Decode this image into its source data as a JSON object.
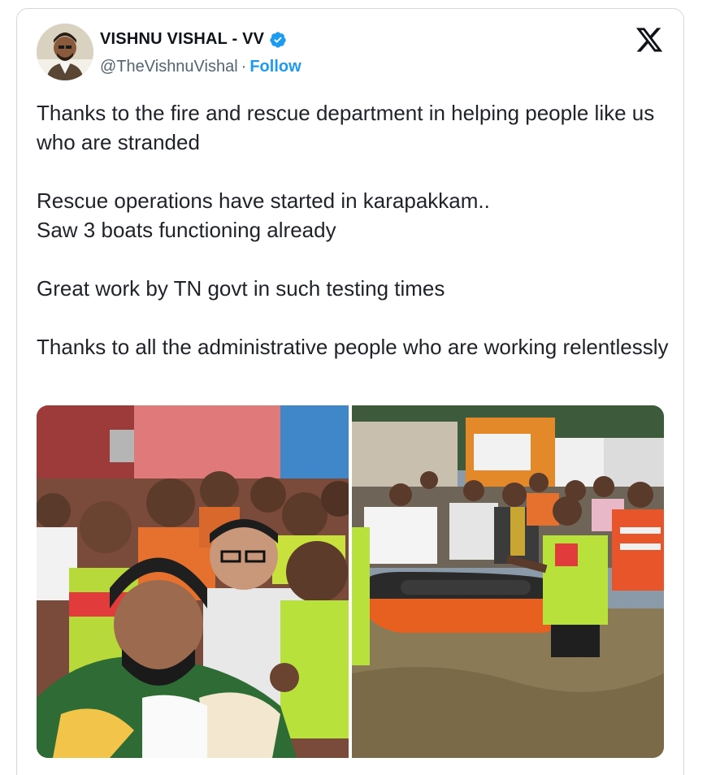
{
  "author": {
    "display_name": "VISHNU VISHAL - VV",
    "handle": "@TheVishnuVishal",
    "separator": "·",
    "follow_label": "Follow",
    "verified": true
  },
  "platform_icon": "x-logo-icon",
  "tweet": {
    "paragraphs": [
      "Thanks to the fire and rescue department in helping people like us who are stranded",
      "Rescue operations have started in karapakkam..\nSaw 3 boats functioning already",
      "Great work by TN govt in such testing times",
      "Thanks to all the administrative people who are working relentlessly"
    ]
  },
  "media": {
    "photos": [
      {
        "kind": "group-selfie-photo"
      },
      {
        "kind": "flood-rescue-boat-photo"
      }
    ]
  },
  "colors": {
    "link_blue": "#1d9bf0",
    "verified_blue": "#1d9bf0",
    "text_primary": "#0f1419",
    "text_secondary": "#536471",
    "border": "#cfd9de"
  }
}
